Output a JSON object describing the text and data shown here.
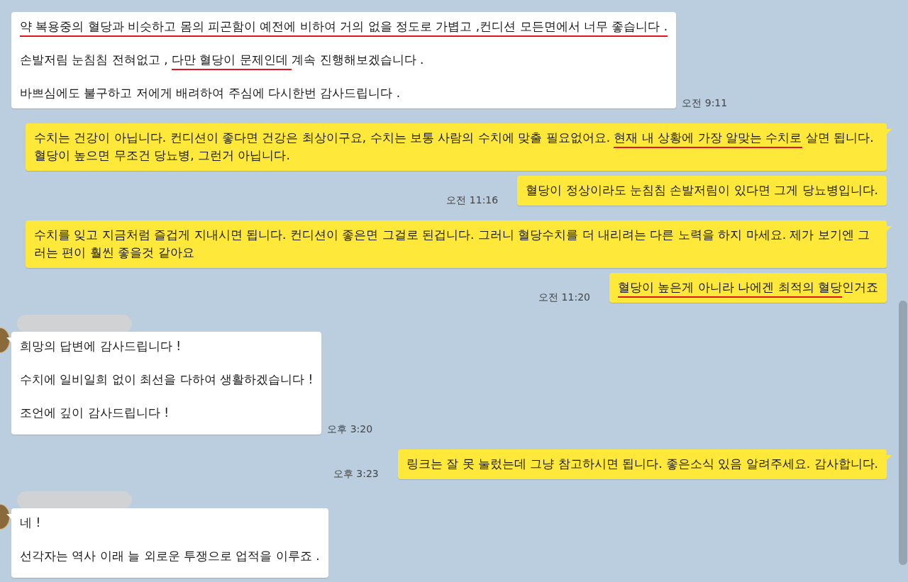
{
  "messages": [
    {
      "kind": "received",
      "sender_shown": false,
      "tail": false,
      "time": "오전 9:11",
      "paragraphs": [
        [
          {
            "text": "약 복용중의 혈당과 비슷하고 몸의 피곤함이 예전에 비하여 거의 없을 정도로 가볍고 ,컨디션 모든면에서 너무 좋습니다 .",
            "underlined": true
          }
        ],
        [
          {
            "text": "손발저림 눈침침 전혀없고 , ",
            "underlined": false
          },
          {
            "text": "다만 혈당이 문제인데 ",
            "underlined": true
          },
          {
            "text": " 계속 진행해보겠습니다 .",
            "underlined": false
          }
        ],
        [
          {
            "text": "바쁘심에도 불구하고 저에게 배려하여 주심에 다시한번 감사드립니다  .",
            "underlined": false
          }
        ]
      ]
    },
    {
      "kind": "sent",
      "sender_shown": false,
      "tail": true,
      "paragraphs": [
        [
          {
            "text": "수치는 건강이 아닙니다. 컨디션이 좋다면 건강은 최상이구요, 수치는 보통 사람의 수치에 맞출 필요없어요. ",
            "underlined": false
          },
          {
            "text": "현재 내 상황에 가장 알맞는 수치로",
            "underlined": true
          },
          {
            "text": " 살면 됩니다. 혈당이 높으면 무조건 당뇨병, 그런거 아닙니다.",
            "underlined": false
          }
        ]
      ]
    },
    {
      "kind": "sent",
      "sender_shown": false,
      "tail": false,
      "time": "오전 11:16",
      "paragraphs": [
        [
          {
            "text": "혈당이 정상이라도 눈침침 손발저림이 있다면 그게 당뇨병입니다.",
            "underlined": false
          }
        ]
      ]
    },
    {
      "kind": "sent",
      "sender_shown": false,
      "tail": true,
      "paragraphs": [
        [
          {
            "text": "수치를 잊고 지금처럼 즐겁게 지내시면 됩니다. 컨디션이 좋은면 그걸로 된겁니다. 그러니 혈당수치를 더 내리려는 다른 노력을 하지 마세요. 제가 보기엔 그러는 편이 훨씬 좋을것 같아요",
            "underlined": false
          }
        ]
      ]
    },
    {
      "kind": "sent",
      "sender_shown": false,
      "tail": false,
      "time": "오전 11:20",
      "paragraphs": [
        [
          {
            "text": "혈당이 높은게 아니라 나에겐 최적의 혈당",
            "underlined": true
          },
          {
            "text": "인거죠",
            "underlined": false
          }
        ]
      ]
    },
    {
      "kind": "received",
      "sender_shown": true,
      "tail": true,
      "time": "오후 3:20",
      "paragraphs": [
        [
          {
            "text": "희망의 답변에 감사드립니다  !",
            "underlined": false
          }
        ],
        [
          {
            "text": "수치에 일비일희 없이 최선을 다하여 생활하겠습니다 !",
            "underlined": false
          }
        ],
        [
          {
            "text": "조언에 깊이 감사드립니다  !",
            "underlined": false
          }
        ]
      ]
    },
    {
      "kind": "sent",
      "sender_shown": false,
      "tail": true,
      "time": "오후 3:23",
      "paragraphs": [
        [
          {
            "text": "링크는 잘 못 눌렀는데 그냥 참고하시면 됩니다. 좋은소식 있음 알려주세요. 감사합니다.",
            "underlined": false
          }
        ]
      ]
    },
    {
      "kind": "received",
      "sender_shown": true,
      "tail": true,
      "paragraphs": [
        [
          {
            "text": "네 !",
            "underlined": false
          }
        ],
        [
          {
            "text": "선각자는 역사 이래 늘 외로운 투쟁으로  업적을 이루죠 .",
            "underlined": false
          }
        ]
      ]
    }
  ]
}
